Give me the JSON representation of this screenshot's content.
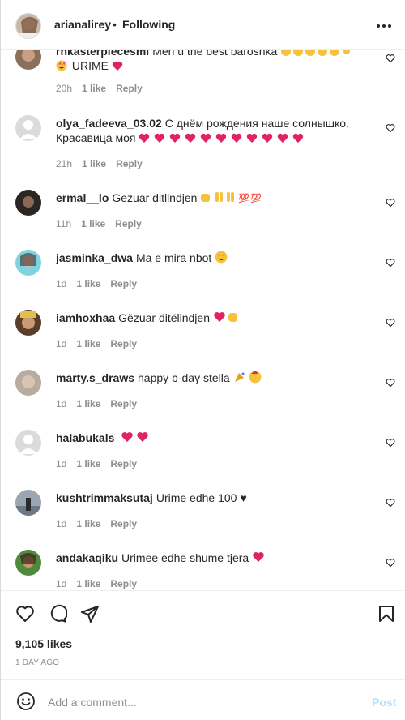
{
  "post_header": {
    "username": "arianalirey",
    "separator": "•",
    "follow_status": "Following",
    "more_icon": "ellipsis-icon"
  },
  "comments": [
    {
      "username": "rnkasterpiecesmi",
      "text": "Men u the best baroshkа",
      "line2": "URIME",
      "time": "20h",
      "likes": "1 like",
      "reply": "Reply"
    },
    {
      "username": "olya_fadeeva_03.02",
      "text": "С днём рождения наше солнышко.",
      "line2": "Красавица моя",
      "time": "21h",
      "likes": "1 like",
      "reply": "Reply"
    },
    {
      "username": "ermal__lo",
      "text": "Gezuar ditlindjen",
      "time": "11h",
      "likes": "1 like",
      "reply": "Reply"
    },
    {
      "username": "jasminka_dwa",
      "text": "Ma e mira nbot",
      "time": "1d",
      "likes": "1 like",
      "reply": "Reply"
    },
    {
      "username": "iamhoxhaa",
      "text": "Gëzuar ditëlindjen",
      "time": "1d",
      "likes": "1 like",
      "reply": "Reply"
    },
    {
      "username": "marty.s_draws",
      "text": "happy b-day stella",
      "time": "1d",
      "likes": "1 like",
      "reply": "Reply"
    },
    {
      "username": "halabukals",
      "text": "",
      "time": "1d",
      "likes": "1 like",
      "reply": "Reply"
    },
    {
      "username": "kushtrimmaksutaj",
      "text": "Urime edhe 100 ♥",
      "time": "1d",
      "likes": "1 like",
      "reply": "Reply"
    },
    {
      "username": "andakaqiku",
      "text": "Urimee edhe shume tjera",
      "time": "1d",
      "likes": "1 like",
      "reply": "Reply"
    }
  ],
  "post_footer": {
    "likes_count": "9,105 likes",
    "time_ago": "1 DAY AGO"
  },
  "add_comment": {
    "placeholder": "Add a comment...",
    "post_label": "Post"
  },
  "colors": {
    "text": "#262626",
    "muted": "#8e8e8e",
    "heart_red": "#e0245e",
    "post_disabled": "#b2dffc",
    "divider": "#efefef"
  }
}
